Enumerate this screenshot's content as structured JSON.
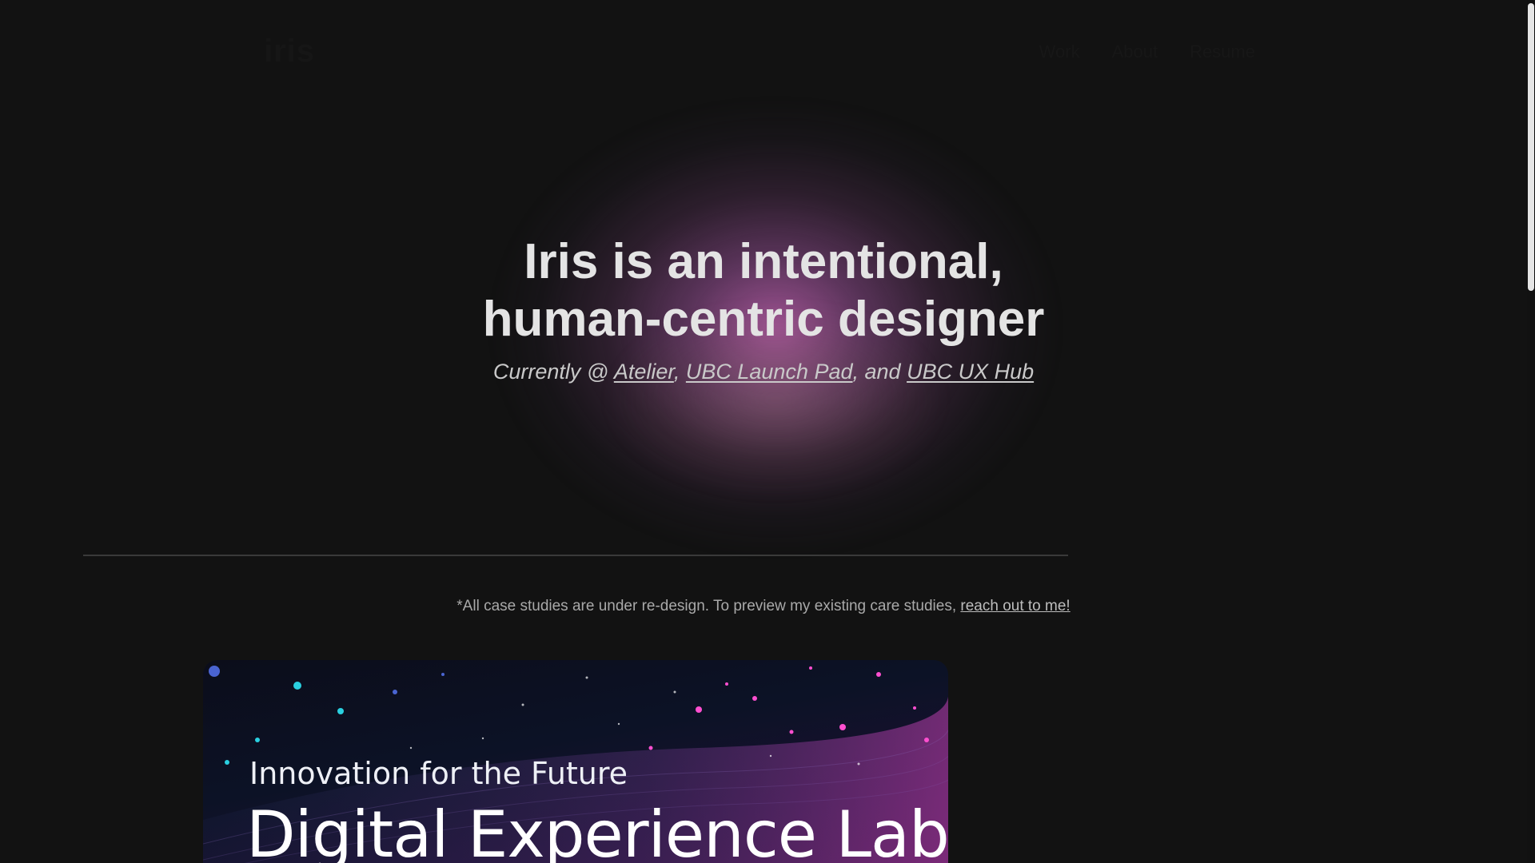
{
  "nav": {
    "logo": "iris",
    "links": [
      "Work",
      "About",
      "Resume"
    ]
  },
  "hero": {
    "title_line1": "Iris is an intentional,",
    "title_line2": "human-centric designer",
    "subtitle_prefix": "Currently @ ",
    "orgs": [
      "Atelier",
      "UBC Launch Pad",
      "UBC UX Hub"
    ],
    "sep1": ", ",
    "sep2": ", and "
  },
  "notice": {
    "text": "*All case studies are under re-design. To preview my existing care studies, ",
    "link": "reach out to me!"
  },
  "case_study": {
    "eyebrow": "Innovation for the Future",
    "title": "Digital Experience Lab"
  },
  "colors": {
    "background": "#121212",
    "glow": "#b85faa",
    "text": "#e4e4e4"
  }
}
